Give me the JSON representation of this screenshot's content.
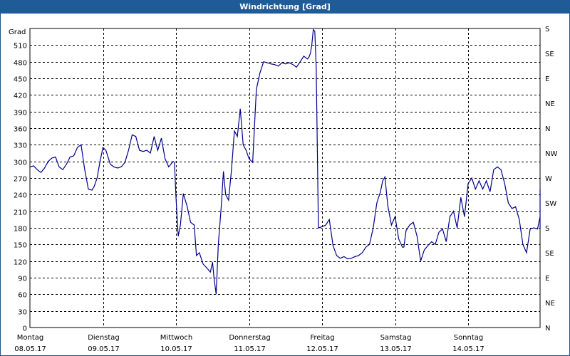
{
  "window": {
    "title": "Windrichtung [Grad]"
  },
  "colors": {
    "titlebar": "#1f5c97",
    "series": "#00008b",
    "grid": "#000000"
  },
  "chart_data": {
    "type": "line",
    "title": "Windrichtung [Grad]",
    "ylabel": "Grad",
    "ylim": [
      0,
      540
    ],
    "yticks": [
      0,
      30,
      60,
      90,
      120,
      150,
      180,
      210,
      240,
      270,
      300,
      330,
      360,
      390,
      420,
      450,
      480,
      510
    ],
    "right_axis_labels": [
      {
        "value": 0,
        "label": "N"
      },
      {
        "value": 45,
        "label": "NE"
      },
      {
        "value": 90,
        "label": "E"
      },
      {
        "value": 135,
        "label": "SE"
      },
      {
        "value": 180,
        "label": "S"
      },
      {
        "value": 225,
        "label": "SW"
      },
      {
        "value": 270,
        "label": "W"
      },
      {
        "value": 315,
        "label": "NW"
      },
      {
        "value": 360,
        "label": "N"
      },
      {
        "value": 405,
        "label": "NE"
      },
      {
        "value": 450,
        "label": "E"
      },
      {
        "value": 495,
        "label": "SE"
      },
      {
        "value": 540,
        "label": "S"
      }
    ],
    "xlim": [
      0,
      6.3
    ],
    "days": [
      {
        "x": 0,
        "name": "Montag",
        "date": "08.05.17"
      },
      {
        "x": 1,
        "name": "Dienstag",
        "date": "09.05.17"
      },
      {
        "x": 2,
        "name": "Mittwoch",
        "date": "10.05.17"
      },
      {
        "x": 3,
        "name": "Donnerstag",
        "date": "11.05.17"
      },
      {
        "x": 4,
        "name": "Freitag",
        "date": "12.05.17"
      },
      {
        "x": 5,
        "name": "Samstag",
        "date": "13.05.17"
      },
      {
        "x": 6,
        "name": "Sonntag",
        "date": "14.05.17"
      }
    ],
    "grid": true,
    "x": [
      0.0,
      0.05,
      0.1,
      0.15,
      0.2,
      0.25,
      0.3,
      0.35,
      0.4,
      0.45,
      0.5,
      0.55,
      0.6,
      0.65,
      0.7,
      0.75,
      0.8,
      0.85,
      0.88,
      0.92,
      0.96,
      1.0,
      1.04,
      1.1,
      1.15,
      1.2,
      1.25,
      1.3,
      1.35,
      1.4,
      1.45,
      1.5,
      1.55,
      1.6,
      1.65,
      1.7,
      1.75,
      1.8,
      1.85,
      1.9,
      1.93,
      1.96,
      1.98,
      2.0,
      2.03,
      2.06,
      2.1,
      2.15,
      2.2,
      2.25,
      2.28,
      2.32,
      2.37,
      2.42,
      2.47,
      2.5,
      2.52,
      2.55,
      2.58,
      2.62,
      2.65,
      2.68,
      2.72,
      2.76,
      2.8,
      2.84,
      2.88,
      2.92,
      2.96,
      3.0,
      3.05,
      3.1,
      3.15,
      3.2,
      3.25,
      3.3,
      3.35,
      3.4,
      3.45,
      3.5,
      3.55,
      3.6,
      3.65,
      3.7,
      3.75,
      3.8,
      3.82,
      3.84,
      3.86,
      3.88,
      3.9,
      3.92,
      3.95,
      4.0,
      4.05,
      4.1,
      4.15,
      4.2,
      4.25,
      4.3,
      4.35,
      4.4,
      4.45,
      4.5,
      4.55,
      4.6,
      4.65,
      4.7,
      4.75,
      4.8,
      4.83,
      4.86,
      4.9,
      4.95,
      5.0,
      5.05,
      5.1,
      5.12,
      5.15,
      5.2,
      5.25,
      5.3,
      5.35,
      5.4,
      5.45,
      5.5,
      5.55,
      5.6,
      5.65,
      5.7,
      5.75,
      5.8,
      5.85,
      5.9,
      5.95,
      6.0,
      6.05,
      6.1,
      6.15,
      6.2,
      6.25,
      6.3,
      6.35,
      6.4,
      6.45,
      6.5,
      6.55,
      6.6,
      6.65,
      6.7,
      6.75,
      6.8,
      6.85,
      6.9,
      6.95,
      7.0,
      7.05,
      7.1,
      7.15
    ],
    "series": [
      {
        "values": [
          290,
          292,
          285,
          280,
          288,
          300,
          306,
          308,
          290,
          285,
          295,
          308,
          310,
          325,
          330,
          285,
          250,
          248,
          255,
          270,
          300,
          325,
          320,
          295,
          290,
          288,
          290,
          298,
          320,
          348,
          345,
          320,
          318,
          320,
          315,
          345,
          320,
          342,
          305,
          290,
          295,
          300,
          298,
          235,
          165,
          185,
          242,
          220,
          190,
          185,
          130,
          135,
          115,
          108,
          100,
          118,
          90,
          60,
          150,
          220,
          282,
          240,
          230,
          285,
          355,
          345,
          395,
          330,
          320,
          305,
          298,
          430,
          460,
          480,
          478,
          476,
          475,
          472,
          478,
          476,
          478,
          475,
          470,
          480,
          490,
          485,
          488,
          495,
          510,
          538,
          535,
          470,
          180,
          182,
          185,
          195,
          148,
          130,
          125,
          128,
          124,
          125,
          128,
          130,
          135,
          145,
          150,
          180,
          225,
          245,
          265,
          272,
          220,
          185,
          200,
          160,
          145,
          145,
          175,
          185,
          190,
          165,
          120,
          140,
          148,
          155,
          150,
          172,
          178,
          155,
          200,
          210,
          180,
          235,
          200,
          260,
          270,
          250,
          265,
          250,
          265,
          245,
          285,
          290,
          285,
          260,
          225,
          215,
          218,
          195,
          150,
          135,
          178,
          180,
          178,
          200,
          190,
          178,
          250,
          260,
          265,
          235,
          255,
          245,
          260,
          270,
          280
        ]
      }
    ]
  }
}
